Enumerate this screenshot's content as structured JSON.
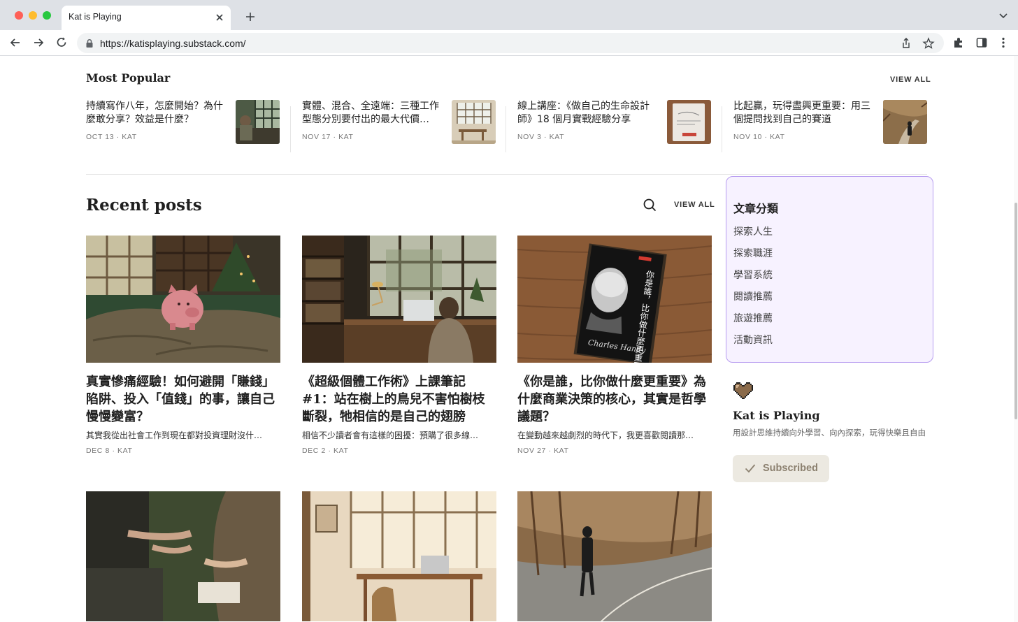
{
  "browser": {
    "tab_title": "Kat is Playing",
    "url": "https://katisplaying.substack.com/"
  },
  "most_popular": {
    "heading": "Most Popular",
    "view_all": "VIEW ALL",
    "items": [
      {
        "title": "持續寫作八年，怎麼開始？為什麼敢分享？效益是什麼？",
        "meta": "OCT 13 · KAT"
      },
      {
        "title": "實體、混合、全遠端：三種工作型態分別要付出的最大代價…",
        "meta": "NOV 17 · KAT"
      },
      {
        "title": "線上講座：《做自己的生命設計師》18 個月實戰經驗分享",
        "meta": "NOV 3 · KAT"
      },
      {
        "title": "比起贏，玩得盡興更重要：用三個提問找到自己的賽道",
        "meta": "NOV 10 · KAT"
      }
    ]
  },
  "recent_posts": {
    "heading": "Recent posts",
    "view_all": "VIEW ALL",
    "posts": [
      {
        "title": "真實慘痛經驗！如何避開「賺錢」陷阱、投入「值錢」的事，讓自己慢慢變富？",
        "subtitle": "其實我從出社會工作到現在都對投資理財沒什…",
        "meta": "DEC 8 · KAT"
      },
      {
        "title": "《超級個體工作術》上課筆記 #1：站在樹上的鳥兒不害怕樹枝斷裂，牠相信的是自己的翅膀",
        "subtitle": "相信不少讀者會有這樣的困擾：預購了很多線…",
        "meta": "DEC 2 · KAT"
      },
      {
        "title": "《你是誰，比你做什麼更重要》為什麼商業決策的核心，其實是哲學議題？",
        "subtitle": "在變動越來越劇烈的時代下，我更喜歡閱讀那…",
        "meta": "NOV 27 · KAT"
      }
    ]
  },
  "categories": {
    "heading": "文章分類",
    "items": [
      "探索人生",
      "探索職涯",
      "學習系統",
      "閱讀推薦",
      "旅遊推薦",
      "活動資訊"
    ]
  },
  "publication": {
    "name": "Kat is Playing",
    "description": "用設計思維持續向外學習、向內探索，玩得快樂且自由",
    "subscribe_label": "Subscribed"
  },
  "book_cover": {
    "title": "你是誰，比你做什麼更重要",
    "author": "Charles Handy"
  },
  "colors": {
    "accent_border": "#b79cf0",
    "category_bg": "#f7f2ff",
    "subscribed_bg": "#ece9e1"
  }
}
